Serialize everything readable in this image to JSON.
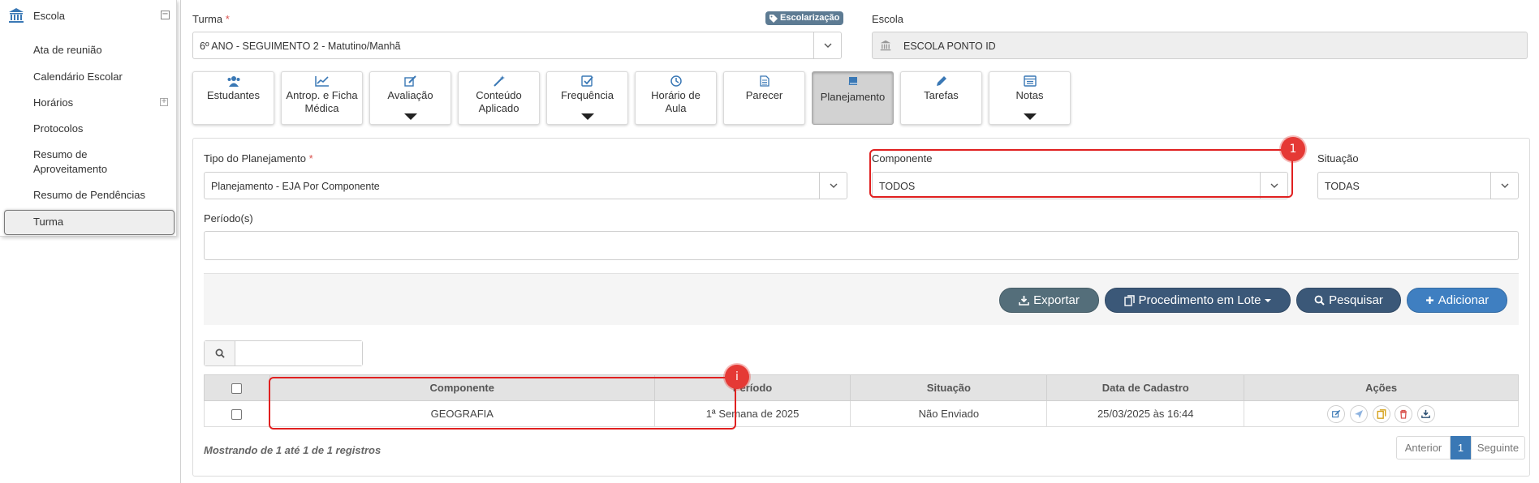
{
  "sidebar": {
    "title": "Escola",
    "items": [
      {
        "label": "Ata de reunião"
      },
      {
        "label": "Calendário Escolar"
      },
      {
        "label": "Horários"
      },
      {
        "label": "Protocolos"
      },
      {
        "label": "Resumo de Aproveitamento"
      },
      {
        "label": "Resumo de Pendências"
      }
    ],
    "active_item": "Turma"
  },
  "header": {
    "turma_label": "Turma",
    "turma_value": "6º ANO - SEGUIMENTO 2 - Matutino/Manhã",
    "badge": "Escolarização",
    "escola_label": "Escola",
    "escola_value": "ESCOLA PONTO ID"
  },
  "tabs": [
    {
      "label": "Estudantes",
      "icon": "users-icon",
      "active": false
    },
    {
      "label": "Antrop. e Ficha Médica",
      "icon": "line-chart-icon",
      "active": false
    },
    {
      "label": "Avaliação",
      "icon": "edit-icon",
      "active": false
    },
    {
      "label": "Conteúdo Aplicado",
      "icon": "magic-wand-icon",
      "active": false
    },
    {
      "label": "Frequência",
      "icon": "check-square-icon",
      "active": false
    },
    {
      "label": "Horário de Aula",
      "icon": "clock-icon",
      "active": false
    },
    {
      "label": "Parecer",
      "icon": "file-text-icon",
      "active": false
    },
    {
      "label": "Planejamento",
      "icon": "book-icon",
      "active": true
    },
    {
      "label": "Tarefas",
      "icon": "pencil-icon",
      "active": false
    },
    {
      "label": "Notas",
      "icon": "list-icon",
      "active": false
    }
  ],
  "filters": {
    "tipo_label": "Tipo do Planejamento",
    "tipo_value": "Planejamento - EJA Por Componente",
    "componente_label": "Componente",
    "componente_value": "TODOS",
    "situacao_label": "Situação",
    "situacao_value": "TODAS",
    "periodo_label": "Período(s)",
    "periodo_value": ""
  },
  "actions": {
    "exportar": "Exportar",
    "procedimento": "Procedimento em Lote",
    "pesquisar": "Pesquisar",
    "adicionar": "Adicionar"
  },
  "search": {
    "value": ""
  },
  "table": {
    "headers": [
      "Componente",
      "Período",
      "Situação",
      "Data de Cadastro",
      "Ações"
    ],
    "rows": [
      {
        "componente": "GEOGRAFIA",
        "periodo": "1ª Semana de 2025",
        "situacao": "Não Enviado",
        "data": "25/03/2025 às 16:44"
      }
    ]
  },
  "footer": {
    "info": "Mostrando de 1 até 1 de 1 registros",
    "prev": "Anterior",
    "page": "1",
    "next": "Seguinte"
  },
  "annotations": {
    "marker_1": "1",
    "marker_2": "i"
  },
  "colors": {
    "primary": "#3a78b5",
    "exportar_btn": "#546e7a",
    "dark_btn": "#3b5878",
    "add_btn": "#3f7fc1",
    "callout": "#e02020"
  }
}
